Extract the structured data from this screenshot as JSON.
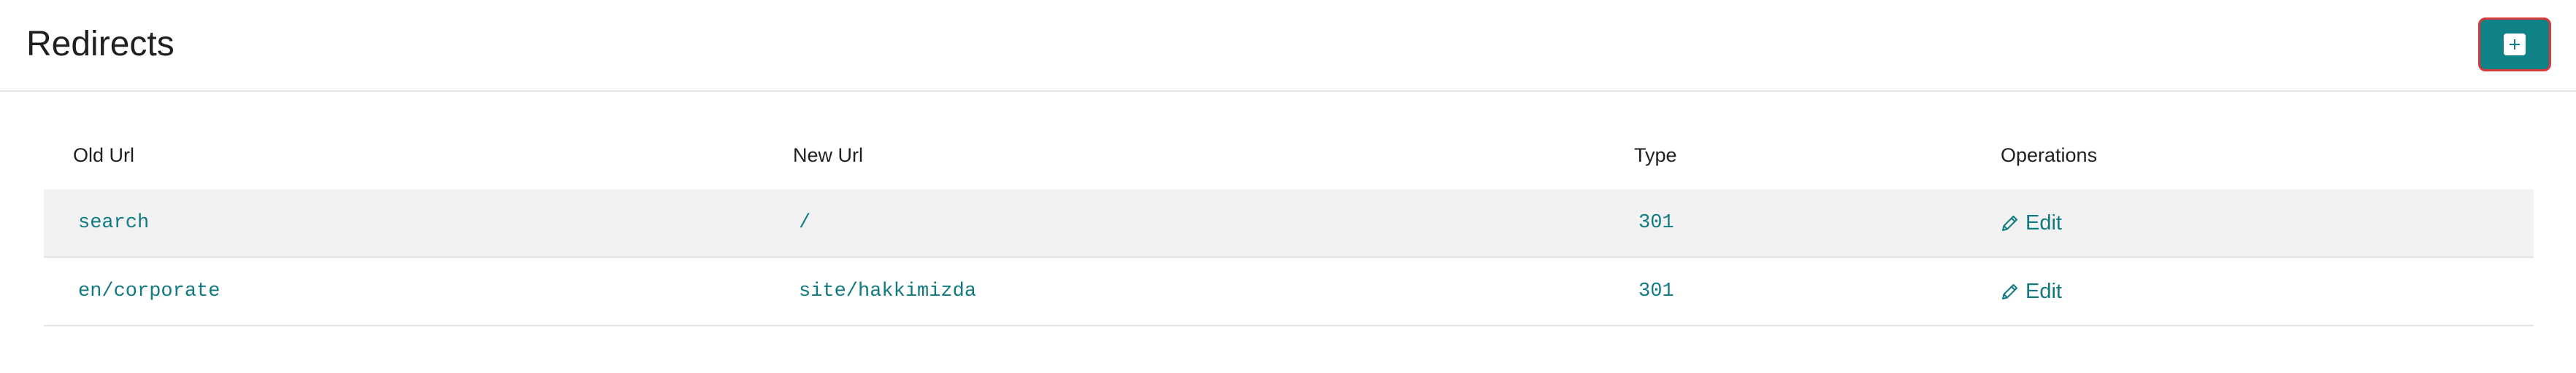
{
  "header": {
    "title": "Redirects",
    "add_button_icon": "plus-icon"
  },
  "table": {
    "columns": [
      "Old Url",
      "New Url",
      "Type",
      "Operations"
    ],
    "rows": [
      {
        "old_url": "search",
        "new_url": "/",
        "type": "301",
        "operation": "Edit"
      },
      {
        "old_url": "en/corporate",
        "new_url": "site/hakkimizda",
        "type": "301",
        "operation": "Edit"
      }
    ]
  },
  "colors": {
    "accent": "#0f8287",
    "link": "#0f7b80",
    "highlight_border": "#d93a3a",
    "row_alt": "#f2f2f2"
  },
  "icons": {
    "edit": "pencil-icon",
    "add": "plus-icon"
  }
}
